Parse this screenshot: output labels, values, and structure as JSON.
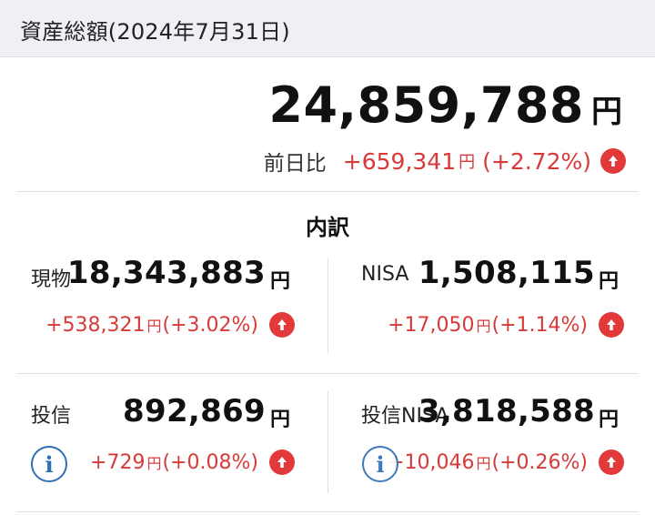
{
  "header": {
    "title": "資産総額(2024年7月31日)"
  },
  "total": {
    "amount": "24,859,788",
    "yen": "円",
    "diff_label": "前日比",
    "diff_amount": "+659,341",
    "diff_yen": "円",
    "diff_pct": "(+2.72%)"
  },
  "breakdown": {
    "title": "内訳",
    "items": [
      {
        "label": "現物",
        "amount": "18,343,883",
        "yen": "円",
        "diff": "+538,321",
        "diff_yen": "円",
        "pct": "(+3.02%)"
      },
      {
        "label": "NISA",
        "amount": "1,508,115",
        "yen": "円",
        "diff": "+17,050",
        "diff_yen": "円",
        "pct": "(+1.14%)"
      },
      {
        "label": "投信",
        "amount": "892,869",
        "yen": "円",
        "diff": "+729",
        "diff_yen": "円",
        "pct": "(+0.08%)"
      },
      {
        "label": "投信NISA",
        "amount": "3,818,588",
        "yen": "円",
        "diff": "+10,046",
        "diff_yen": "円",
        "pct": "(+0.26%)"
      }
    ]
  },
  "icons": {
    "up": "arrow-up-circle-icon",
    "info": "info-icon"
  },
  "colors": {
    "positive": "#d83a3a",
    "up_badge": "#e2393b",
    "info": "#2f6fb5",
    "header_bg": "#eef0f5"
  }
}
